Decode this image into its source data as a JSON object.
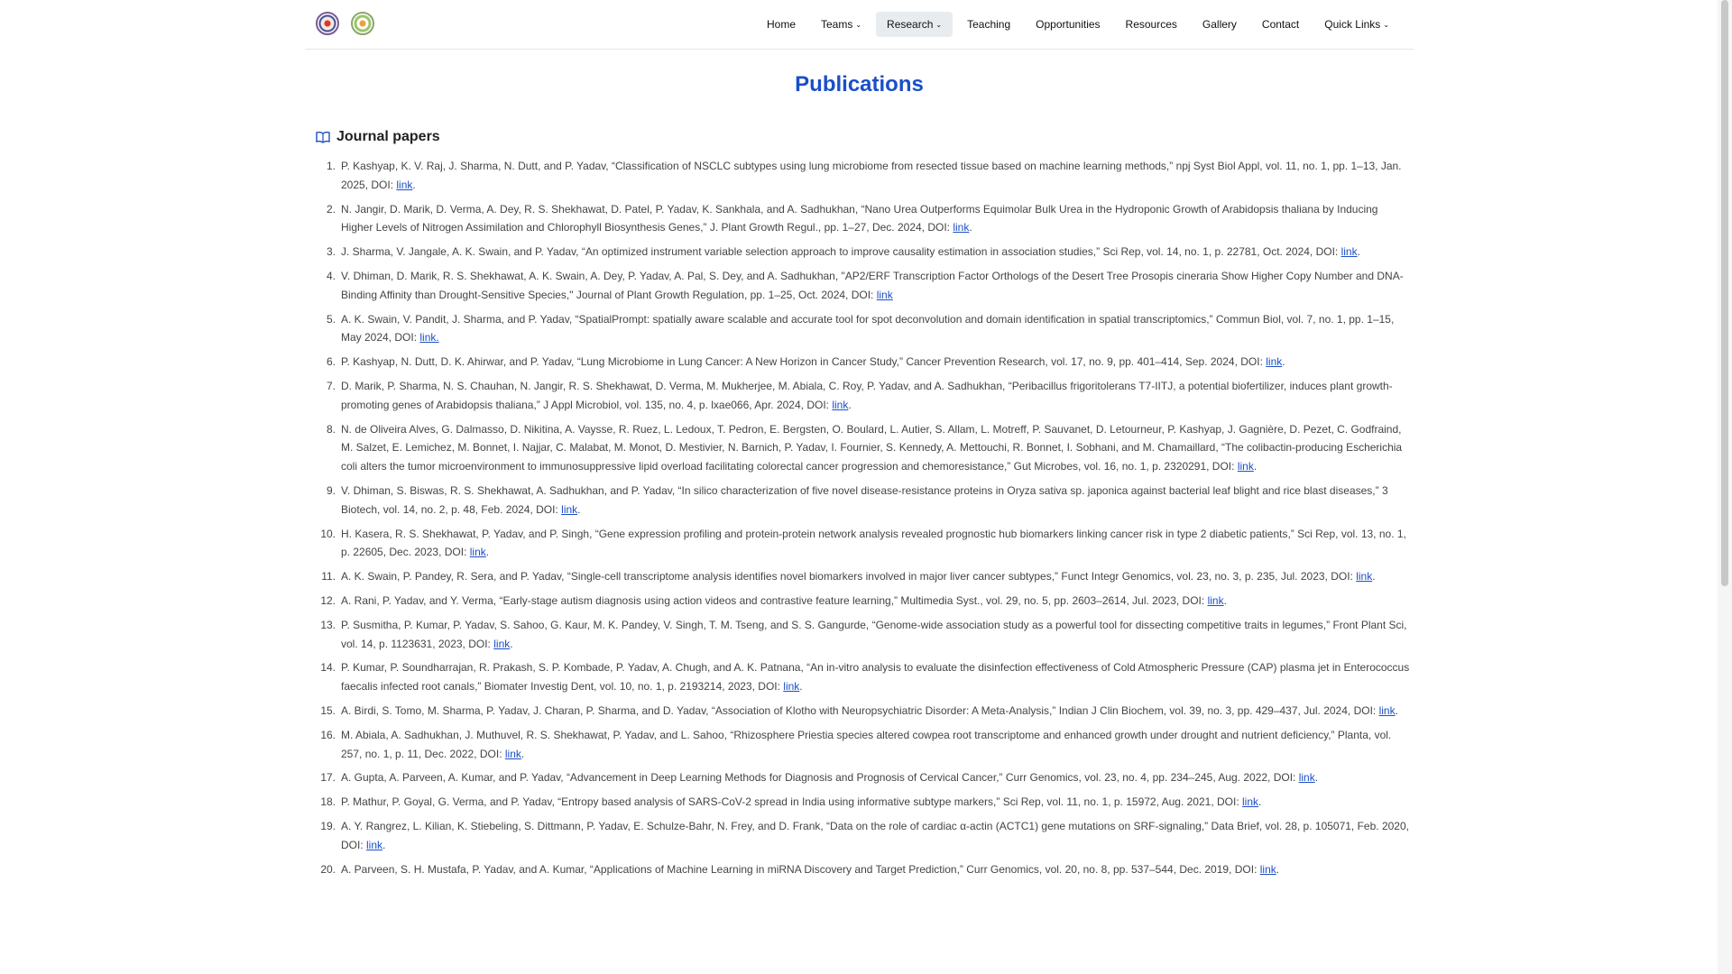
{
  "nav": {
    "items": [
      {
        "label": "Home",
        "dropdown": false,
        "active": false
      },
      {
        "label": "Teams",
        "dropdown": true,
        "active": false
      },
      {
        "label": "Research",
        "dropdown": true,
        "active": true
      },
      {
        "label": "Teaching",
        "dropdown": false,
        "active": false
      },
      {
        "label": "Opportunities",
        "dropdown": false,
        "active": false
      },
      {
        "label": "Resources",
        "dropdown": false,
        "active": false
      },
      {
        "label": "Gallery",
        "dropdown": false,
        "active": false
      },
      {
        "label": "Contact",
        "dropdown": false,
        "active": false
      },
      {
        "label": "Quick Links",
        "dropdown": true,
        "active": false
      }
    ]
  },
  "page": {
    "title": "Publications"
  },
  "section": {
    "title": "Journal papers",
    "icon": "open-book-icon"
  },
  "colors": {
    "accent": "#1a4fc7",
    "text": "#444444"
  },
  "publications": [
    {
      "n": "1.",
      "text": "P. Kashyap, K. V. Raj, J. Sharma, N. Dutt, and P. Yadav, “Classification of NSCLC subtypes using lung microbiome from resected tissue based on machine learning methods,” npj Syst Biol Appl, vol. 11, no. 1, pp. 1–13, Jan. 2025, DOI: ",
      "link": "link",
      "end": "."
    },
    {
      "n": "2.",
      "text": "N. Jangir, D. Marik, D. Verma, A. Dey, R. S. Shekhawat, D. Patel, P. Yadav, K. Sankhala, and A. Sadhukhan, “Nano Urea Outperforms Equimolar Bulk Urea in the Hydroponic Growth of Arabidopsis thaliana by Inducing Higher Levels of Nitrogen Assimilation and Chlorophyll Biosynthesis Genes,” J. Plant Growth Regul., pp. 1–27, Dec. 2024, DOI: ",
      "link": "link",
      "end": "."
    },
    {
      "n": "3.",
      "text": "J. Sharma, V. Jangale, A. K. Swain, and P. Yadav, “An optimized instrument variable selection approach to improve causality estimation in association studies,” Sci Rep, vol. 14, no. 1, p. 22781, Oct. 2024, DOI: ",
      "link": "link",
      "end": "."
    },
    {
      "n": "4.",
      "text": "V. Dhiman, D. Marik, R. S. Shekhawat, A. K. Swain, A. Dey, P. Yadav, A. Pal, S. Dey, and A. Sadhukhan, \"AP2/ERF Transcription Factor Orthologs of the Desert Tree Prosopis cineraria Show Higher Copy Number and DNA-Binding Affinity than Drought-Sensitive Species,\" Journal of Plant Growth Regulation, pp. 1–25, Oct. 2024, DOI: ",
      "link": "link",
      "end": ""
    },
    {
      "n": "5.",
      "text": "A. K. Swain, V. Pandit, J. Sharma, and P. Yadav, “SpatialPrompt: spatially aware scalable and accurate tool for spot deconvolution and domain identification in spatial transcriptomics,” Commun Biol, vol. 7, no. 1, pp. 1–15, May 2024, DOI: ",
      "link": "link.",
      "end": ""
    },
    {
      "n": "6.",
      "text": "P. Kashyap, N. Dutt, D. K. Ahirwar, and P. Yadav, “Lung Microbiome in Lung Cancer: A New Horizon in Cancer Study,” Cancer Prevention Research, vol. 17, no. 9, pp. 401–414, Sep. 2024, DOI: ",
      "link": "link",
      "end": "."
    },
    {
      "n": "7.",
      "text": "D. Marik, P. Sharma, N. S. Chauhan, N. Jangir, R. S. Shekhawat, D. Verma, M. Mukherjee, M. Abiala, C. Roy, P. Yadav, and A. Sadhukhan, “Peribacillus frigoritolerans T7-IITJ, a potential biofertilizer, induces plant growth-promoting genes of Arabidopsis thaliana,” J Appl Microbiol, vol. 135, no. 4, p. lxae066, Apr. 2024, DOI: ",
      "link": "link",
      "end": "."
    },
    {
      "n": "8.",
      "text": "N. de Oliveira Alves, G. Dalmasso, D. Nikitina, A. Vaysse, R. Ruez, L. Ledoux, T. Pedron, E. Bergsten, O. Boulard, L. Autier, S. Allam, L. Motreff, P. Sauvanet, D. Letourneur, P. Kashyap, J. Gagnière, D. Pezet, C. Godfraind, M. Salzet, E. Lemichez, M. Bonnet, I. Najjar, C. Malabat, M. Monot, D. Mestivier, N. Barnich, P. Yadav, I. Fournier, S. Kennedy, A. Mettouchi, R. Bonnet, I. Sobhani, and M. Chamaillard, “The colibactin-producing Escherichia coli alters the tumor microenvironment to immunosuppressive lipid overload facilitating colorectal cancer progression and chemoresistance,” Gut Microbes, vol. 16, no. 1, p. 2320291, DOI: ",
      "link": "link",
      "end": "."
    },
    {
      "n": "9.",
      "text": "V. Dhiman, S. Biswas, R. S. Shekhawat, A. Sadhukhan, and P. Yadav, “In silico characterization of five novel disease-resistance proteins in Oryza sativa sp. japonica against bacterial leaf blight and rice blast diseases,” 3 Biotech, vol. 14, no. 2, p. 48, Feb. 2024, DOI: ",
      "link": "link",
      "end": "."
    },
    {
      "n": "10.",
      "text": "H. Kasera, R. S. Shekhawat, P. Yadav, and P. Singh, “Gene expression profiling and protein-protein network analysis revealed prognostic hub biomarkers linking cancer risk in type 2 diabetic patients,” Sci Rep, vol. 13, no. 1, p. 22605, Dec. 2023, DOI: ",
      "link": "link",
      "end": "."
    },
    {
      "n": "11.",
      "text": "A. K. Swain, P. Pandey, R. Sera, and P. Yadav, “Single-cell transcriptome analysis identifies novel biomarkers involved in major liver cancer subtypes,” Funct Integr Genomics, vol. 23, no. 3, p. 235, Jul. 2023, DOI: ",
      "link": "link",
      "end": "."
    },
    {
      "n": "12.",
      "text": "A. Rani, P. Yadav, and Y. Verma, “Early-stage autism diagnosis using action videos and contrastive feature learning,” Multimedia Syst., vol. 29, no. 5, pp. 2603–2614, Jul. 2023, DOI: ",
      "link": "link",
      "end": "."
    },
    {
      "n": "13.",
      "text": "P. Susmitha, P. Kumar, P. Yadav, S. Sahoo, G. Kaur, M. K. Pandey, V. Singh, T. M. Tseng, and S. S. Gangurde, “Genome-wide association study as a powerful tool for dissecting competitive traits in legumes,” Front Plant Sci, vol. 14, p. 1123631, 2023, DOI: ",
      "link": "link",
      "end": "."
    },
    {
      "n": "14.",
      "text": "P. Kumar, P. Soundharrajan, R. Prakash, S. P. Kombade, P. Yadav, A. Chugh, and A. K. Patnana, “An in-vitro analysis to evaluate the disinfection effectiveness of Cold Atmospheric Pressure (CAP) plasma jet in Enterococcus faecalis infected root canals,” Biomater Investig Dent, vol. 10, no. 1, p. 2193214, 2023, DOI: ",
      "link": "link",
      "end": "."
    },
    {
      "n": "15.",
      "text": "A. Birdi, S. Tomo, M. Sharma, P. Yadav, J. Charan, P. Sharma, and D. Yadav, “Association of Klotho with Neuropsychiatric Disorder: A Meta-Analysis,” Indian J Clin Biochem, vol. 39, no. 3, pp. 429–437, Jul. 2024, DOI: ",
      "link": "link",
      "end": "."
    },
    {
      "n": "16.",
      "text": "M. Abiala, A. Sadhukhan, J. Muthuvel, R. S. Shekhawat, P. Yadav, and L. Sahoo, “Rhizosphere Priestia species altered cowpea root transcriptome and enhanced growth under drought and nutrient deficiency,” Planta, vol. 257, no. 1, p. 11, Dec. 2022, DOI: ",
      "link": "link",
      "end": "."
    },
    {
      "n": "17.",
      "text": "A. Gupta, A. Parveen, A. Kumar, and P. Yadav, “Advancement in Deep Learning Methods for Diagnosis and Prognosis of Cervical Cancer,” Curr Genomics, vol. 23, no. 4, pp. 234–245, Aug. 2022, DOI: ",
      "link": "link",
      "end": "."
    },
    {
      "n": "18.",
      "text": "P. Mathur, P. Goyal, G. Verma, and P. Yadav, “Entropy based analysis of SARS-CoV-2 spread in India using informative subtype markers,” Sci Rep, vol. 11, no. 1, p. 15972, Aug. 2021, DOI: ",
      "link": "link",
      "end": "."
    },
    {
      "n": "19.",
      "text": "A. Y. Rangrez, L. Kilian, K. Stiebeling, S. Dittmann, P. Yadav, E. Schulze-Bahr, N. Frey, and D. Frank, “Data on the role of cardiac α-actin (ACTC1) gene mutations on SRF-signaling,” Data Brief, vol. 28, p. 105071, Feb. 2020, DOI: ",
      "link": "link",
      "end": "."
    },
    {
      "n": "20.",
      "text": "A. Parveen, S. H. Mustafa, P. Yadav, and A. Kumar, “Applications of Machine Learning in miRNA Discovery and Target Prediction,” Curr Genomics, vol. 20, no. 8, pp. 537–544, Dec. 2019, DOI: ",
      "link": "link",
      "end": "."
    }
  ]
}
